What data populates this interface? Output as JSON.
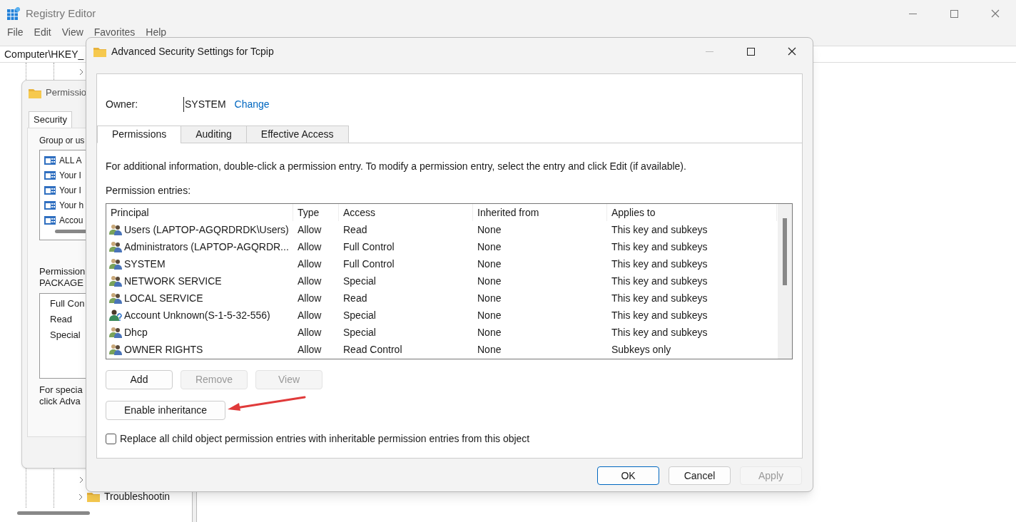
{
  "registry": {
    "title": "Registry Editor",
    "menu": [
      "File",
      "Edit",
      "View",
      "Favorites",
      "Help"
    ],
    "address": "Computer\\HKEY_",
    "tree": [
      {
        "label": "Troubleshootin"
      }
    ]
  },
  "permissions_dialog": {
    "title": "Permissio",
    "tabs": [
      {
        "label": "Security",
        "selected": true
      }
    ],
    "group_label": "Group or us",
    "principals": [
      "ALL A",
      "Your I",
      "Your I",
      "Your h",
      "Accou"
    ],
    "perm_label": [
      "Permission",
      "PACKAGE"
    ],
    "permissions": [
      "Full Con",
      "Read",
      "Special"
    ],
    "note": [
      "For specia",
      "click Adva"
    ]
  },
  "dialog": {
    "title": "Advanced Security Settings for Tcpip",
    "owner_label": "Owner:",
    "owner": "SYSTEM",
    "change_link": "Change",
    "tabs": [
      {
        "label": "Permissions",
        "selected": true
      },
      {
        "label": "Auditing",
        "selected": false
      },
      {
        "label": "Effective Access",
        "selected": false
      }
    ],
    "info": "For additional information, double-click a permission entry. To modify a permission entry, select the entry and click Edit (if available).",
    "entries_label": "Permission entries:",
    "table": {
      "columns": [
        "Principal",
        "Type",
        "Access",
        "Inherited from",
        "Applies to"
      ],
      "rows": [
        {
          "kind": "group",
          "cells": [
            "Users (LAPTOP-AGQRDRDK\\Users)",
            "Allow",
            "Read",
            "None",
            "This key and subkeys"
          ]
        },
        {
          "kind": "group",
          "cells": [
            "Administrators (LAPTOP-AGQRDR...",
            "Allow",
            "Full Control",
            "None",
            "This key and subkeys"
          ]
        },
        {
          "kind": "group",
          "cells": [
            "SYSTEM",
            "Allow",
            "Full Control",
            "None",
            "This key and subkeys"
          ]
        },
        {
          "kind": "group",
          "cells": [
            "NETWORK SERVICE",
            "Allow",
            "Special",
            "None",
            "This key and subkeys"
          ]
        },
        {
          "kind": "group",
          "cells": [
            "LOCAL SERVICE",
            "Allow",
            "Read",
            "None",
            "This key and subkeys"
          ]
        },
        {
          "kind": "unknown",
          "cells": [
            "Account Unknown(S-1-5-32-556)",
            "Allow",
            "Special",
            "None",
            "This key and subkeys"
          ]
        },
        {
          "kind": "group",
          "cells": [
            "Dhcp",
            "Allow",
            "Special",
            "None",
            "This key and subkeys"
          ]
        },
        {
          "kind": "group",
          "cells": [
            "OWNER RIGHTS",
            "Allow",
            "Read Control",
            "None",
            "Subkeys only"
          ]
        }
      ]
    },
    "entry_buttons": [
      {
        "label": "Add",
        "disabled": false
      },
      {
        "label": "Remove",
        "disabled": true
      },
      {
        "label": "View",
        "disabled": true
      }
    ],
    "inheritance_button": "Enable inheritance",
    "replace_checkbox": {
      "label": "Replace all child object permission entries with inheritable permission entries from this object",
      "checked": false
    },
    "footer_buttons": [
      {
        "label": "OK",
        "disabled": false,
        "default": true
      },
      {
        "label": "Cancel",
        "disabled": false,
        "default": false
      },
      {
        "label": "Apply",
        "disabled": true,
        "default": false
      }
    ]
  }
}
